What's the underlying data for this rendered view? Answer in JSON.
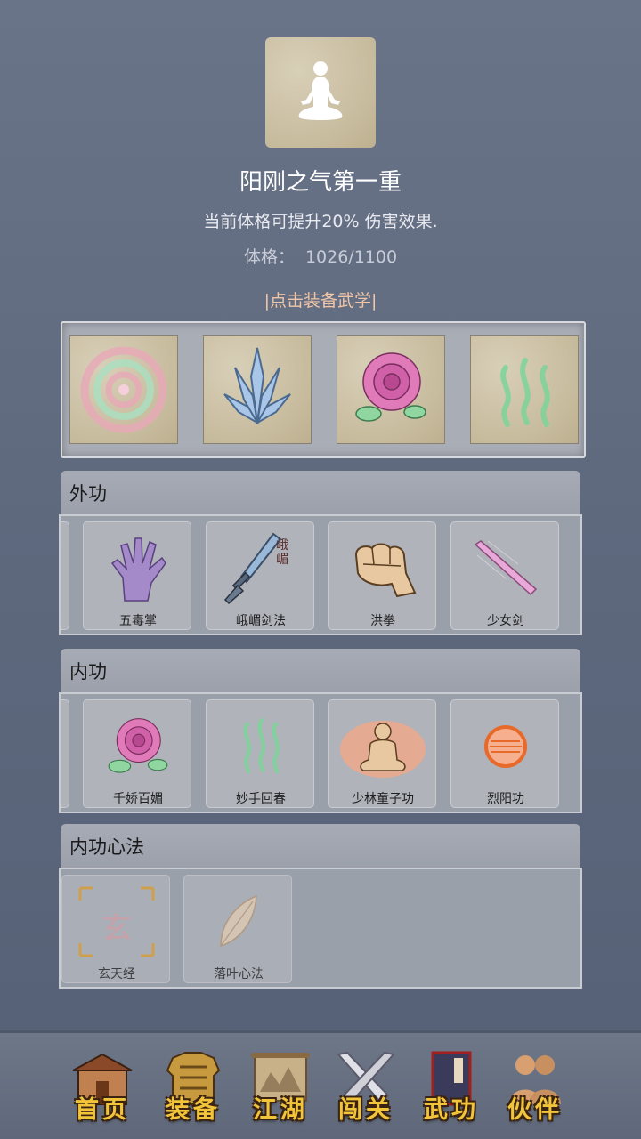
{
  "skill": {
    "icon": "meditation-figure-icon",
    "title": "阳刚之气第一重",
    "description": "当前体格可提升20% 伤害效果.",
    "stat_label": "体格：",
    "stat_value": "1026/1100"
  },
  "equip_hint": "|点击装备武学|",
  "equipped": [
    {
      "icon": "spiral-icon"
    },
    {
      "icon": "crystal-blades-icon"
    },
    {
      "icon": "rose-icon"
    },
    {
      "icon": "green-waves-icon"
    }
  ],
  "sections": {
    "waigong": {
      "title": "外功",
      "items": [
        {
          "label": "五毒掌",
          "icon": "purple-palm-icon"
        },
        {
          "label": "峨嵋剑法",
          "icon": "sword-icon"
        },
        {
          "label": "洪拳",
          "icon": "fist-icon"
        },
        {
          "label": "少女剑",
          "icon": "pink-blade-icon"
        }
      ]
    },
    "neigong": {
      "title": "内功",
      "items": [
        {
          "label": "千娇百媚",
          "icon": "rose-icon"
        },
        {
          "label": "妙手回春",
          "icon": "green-waves-icon"
        },
        {
          "label": "少林童子功",
          "icon": "monk-icon"
        },
        {
          "label": "烈阳功",
          "icon": "sun-orb-icon"
        }
      ]
    },
    "xinfa": {
      "title": "内功心法",
      "items": [
        {
          "label": "玄天经",
          "icon": "xuan-scroll-icon",
          "glyph": "玄"
        },
        {
          "label": "落叶心法",
          "icon": "leaf-icon"
        }
      ]
    }
  },
  "sword_glyph": "峨嵋",
  "nav": [
    {
      "label": "首页",
      "icon": "house-icon"
    },
    {
      "label": "装备",
      "icon": "armor-icon"
    },
    {
      "label": "江湖",
      "icon": "map-scroll-icon"
    },
    {
      "label": "闯关",
      "icon": "crossed-swords-icon"
    },
    {
      "label": "武功",
      "icon": "book-icon"
    },
    {
      "label": "伙伴",
      "icon": "partners-icon"
    }
  ],
  "colors": {
    "background": "#5e687d",
    "hint": "#f0c6a8",
    "nav_label": "#f2c43a"
  }
}
